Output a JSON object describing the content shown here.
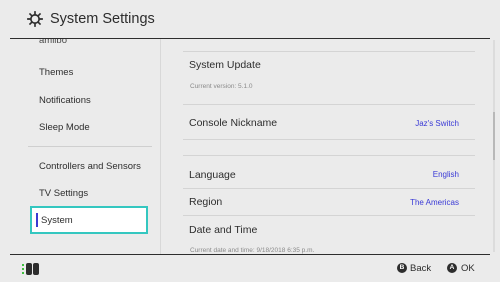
{
  "header": {
    "title": "System Settings",
    "icon": "gear-icon"
  },
  "sidebar": {
    "cut_item": "amiibo",
    "items": [
      {
        "label": "Themes"
      },
      {
        "label": "Notifications"
      },
      {
        "label": "Sleep Mode"
      },
      {
        "label": "Controllers and Sensors"
      },
      {
        "label": "TV Settings"
      },
      {
        "label": "System",
        "selected": true
      }
    ]
  },
  "main": {
    "system_update": {
      "label": "System Update",
      "sub": "Current version: 5.1.0"
    },
    "console_nickname": {
      "label": "Console Nickname",
      "value": "Jaz's Switch"
    },
    "language": {
      "label": "Language",
      "value": "English"
    },
    "region": {
      "label": "Region",
      "value": "The Americas"
    },
    "date_time": {
      "label": "Date and Time",
      "sub": "Current date and time: 9/18/2018 6:35 p.m."
    }
  },
  "footer": {
    "back": {
      "glyph": "B",
      "label": "Back"
    },
    "ok": {
      "glyph": "A",
      "label": "OK"
    }
  },
  "colors": {
    "accent": "#34c7c0",
    "value_blue": "#3a3ad6",
    "selection_bar": "#3b3ad1"
  }
}
